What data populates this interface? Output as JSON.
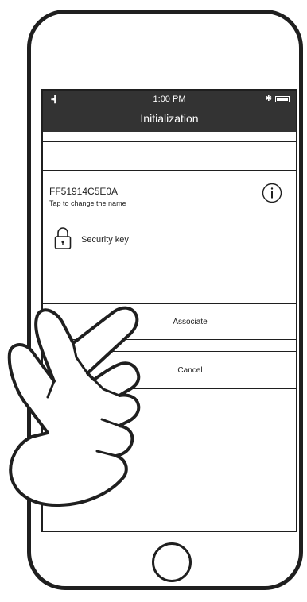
{
  "status_bar": {
    "signal": "••▎",
    "time": "1:00 PM",
    "bluetooth": "✱"
  },
  "header": {
    "title": "Initialization"
  },
  "device": {
    "name": "FF51914C5E0A",
    "hint": "Tap to change the name"
  },
  "security": {
    "label": "Security key"
  },
  "actions": {
    "associate_label": "Associate",
    "cancel_label": "Cancel"
  },
  "colors": {
    "status_bar_bg": "#333333",
    "outline": "#1f1f1f"
  },
  "icons": [
    "info-icon",
    "lock-icon",
    "battery-icon",
    "bluetooth-icon",
    "signal-icon",
    "home-button",
    "pointing-hand"
  ]
}
